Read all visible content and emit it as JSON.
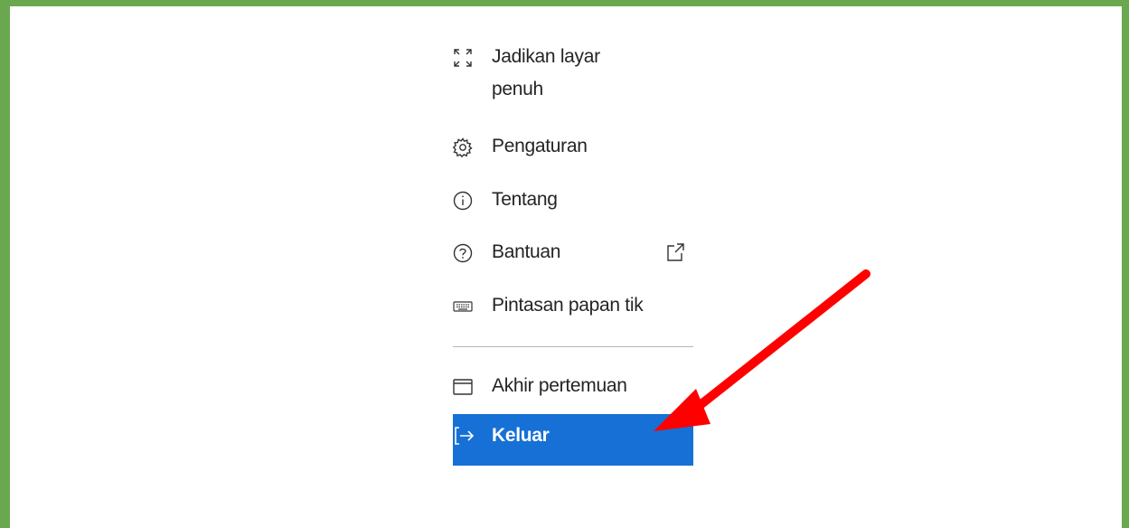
{
  "menu": {
    "items": [
      {
        "label_line1": "Jadikan layar",
        "label_line2": "penuh",
        "icon": "fullscreen-icon"
      },
      {
        "label": "Pengaturan",
        "icon": "gear-icon"
      },
      {
        "label": "Tentang",
        "icon": "info-icon"
      },
      {
        "label": "Bantuan",
        "icon": "help-icon",
        "trailing_icon": "external-link-icon"
      },
      {
        "label": "Pintasan papan tik",
        "icon": "keyboard-icon"
      },
      {
        "label": "Akhir pertemuan",
        "icon": "window-icon"
      },
      {
        "label": "Keluar",
        "icon": "sign-out-icon",
        "selected": true
      }
    ]
  },
  "colors": {
    "frame_border": "#6aa84f",
    "selected_background": "#1670d6",
    "annotation_arrow": "#ff0000"
  }
}
